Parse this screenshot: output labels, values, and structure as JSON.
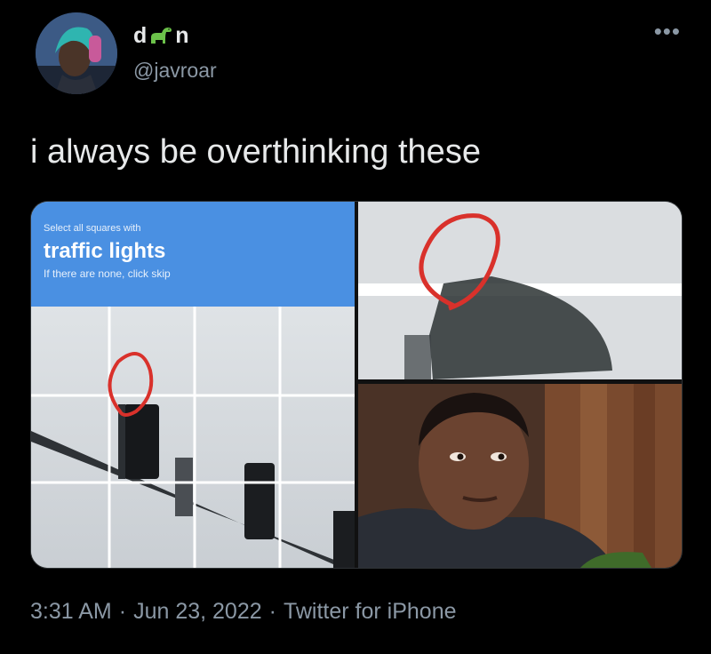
{
  "user": {
    "display_name_prefix": "d",
    "display_name_suffix": "n",
    "emoji_icon": "sauropod-icon",
    "handle": "@javroar"
  },
  "more_icon": "more-icon",
  "more_glyph": "•••",
  "tweet": {
    "text": "i always be overthinking these"
  },
  "captcha": {
    "instruction_small": "Select all squares with",
    "target": "traffic lights",
    "hint": "If there are none, click skip"
  },
  "meta": {
    "time": "3:31 AM",
    "sep1": "·",
    "date": "Jun 23, 2022",
    "sep2": "·",
    "source": "Twitter for iPhone"
  },
  "colors": {
    "background": "#000000",
    "text": "#e7e9ea",
    "muted": "#8b98a5",
    "captcha_blue": "#4a90e2",
    "circle_red": "#d9312b"
  }
}
